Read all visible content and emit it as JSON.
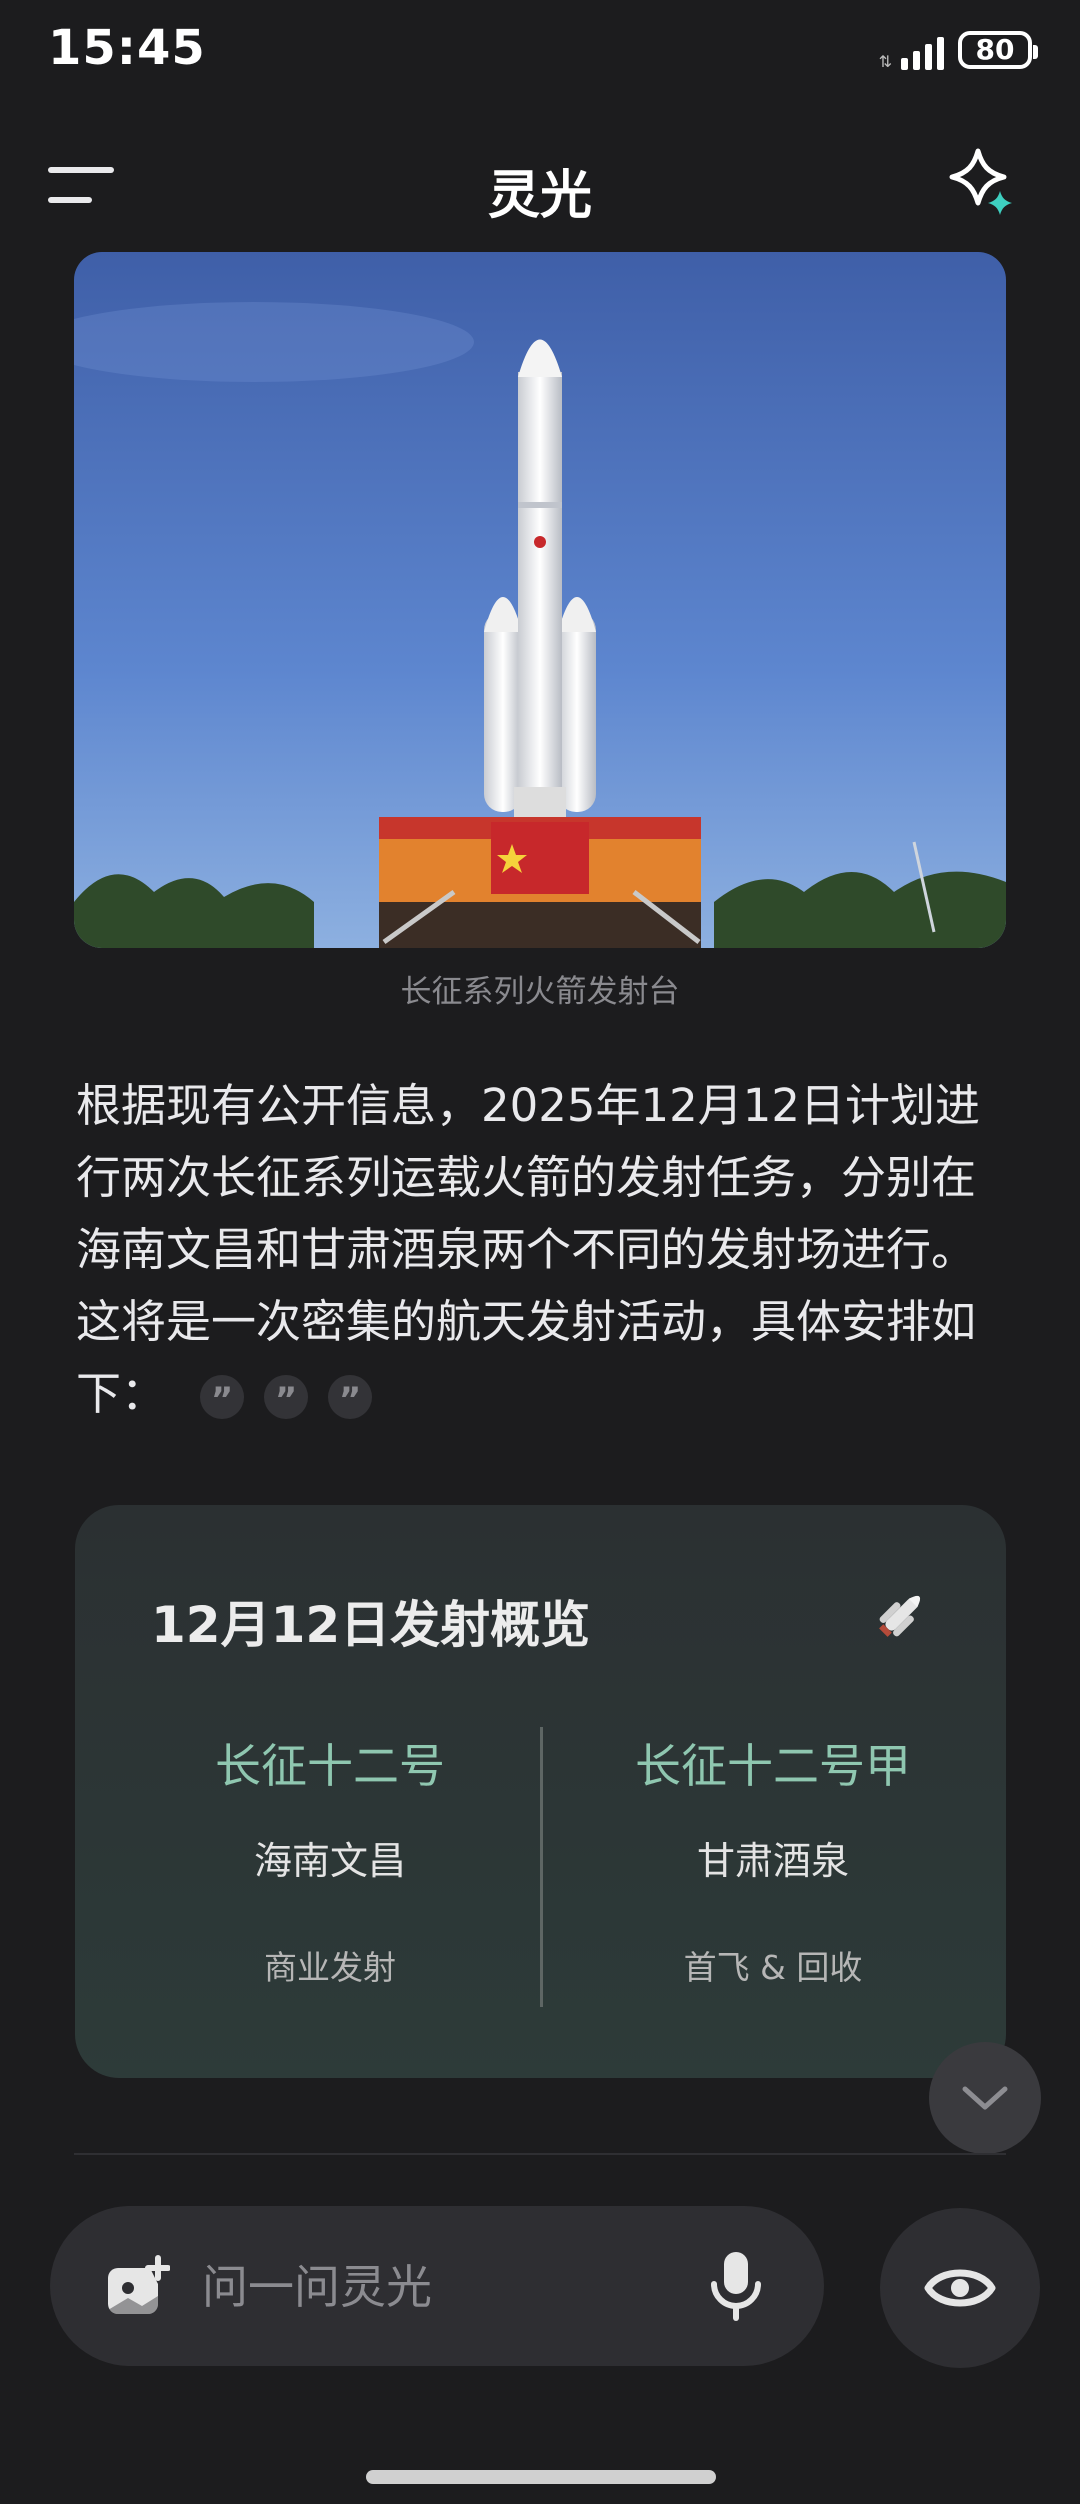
{
  "status_bar": {
    "time": "15:45",
    "network_tiny": "⇅",
    "battery": "80"
  },
  "header": {
    "title": "灵光"
  },
  "image": {
    "caption": "长征系列火箭发射台"
  },
  "answer": {
    "text": "根据现有公开信息，2025年12月12日计划进行两次长征系列运载火箭的发射任务，分别在海南文昌和甘肃酒泉两个不同的发射场进行。这将是一次密集的航天发射活动，具体安排如下："
  },
  "card": {
    "title": "12月12日发射概览",
    "left": {
      "name": "长征十二号",
      "location": "海南文昌",
      "note": "商业发射"
    },
    "right": {
      "name": "长征十二号甲",
      "location": "甘肃酒泉",
      "note": "首飞 & 回收"
    }
  },
  "input": {
    "placeholder": "问一问灵光"
  },
  "icons": {
    "menu": "menu-icon",
    "spark": "sparkle-icon",
    "quote": "quote-icon",
    "rocket": "rocket-icon",
    "scroll": "chevron-down-icon",
    "photo": "add-photo-icon",
    "mic": "microphone-icon",
    "eye": "eye-icon"
  },
  "colors": {
    "background": "#1c1c1e",
    "accent_teal": "#8fc7b0",
    "card": "#2d3b39"
  }
}
